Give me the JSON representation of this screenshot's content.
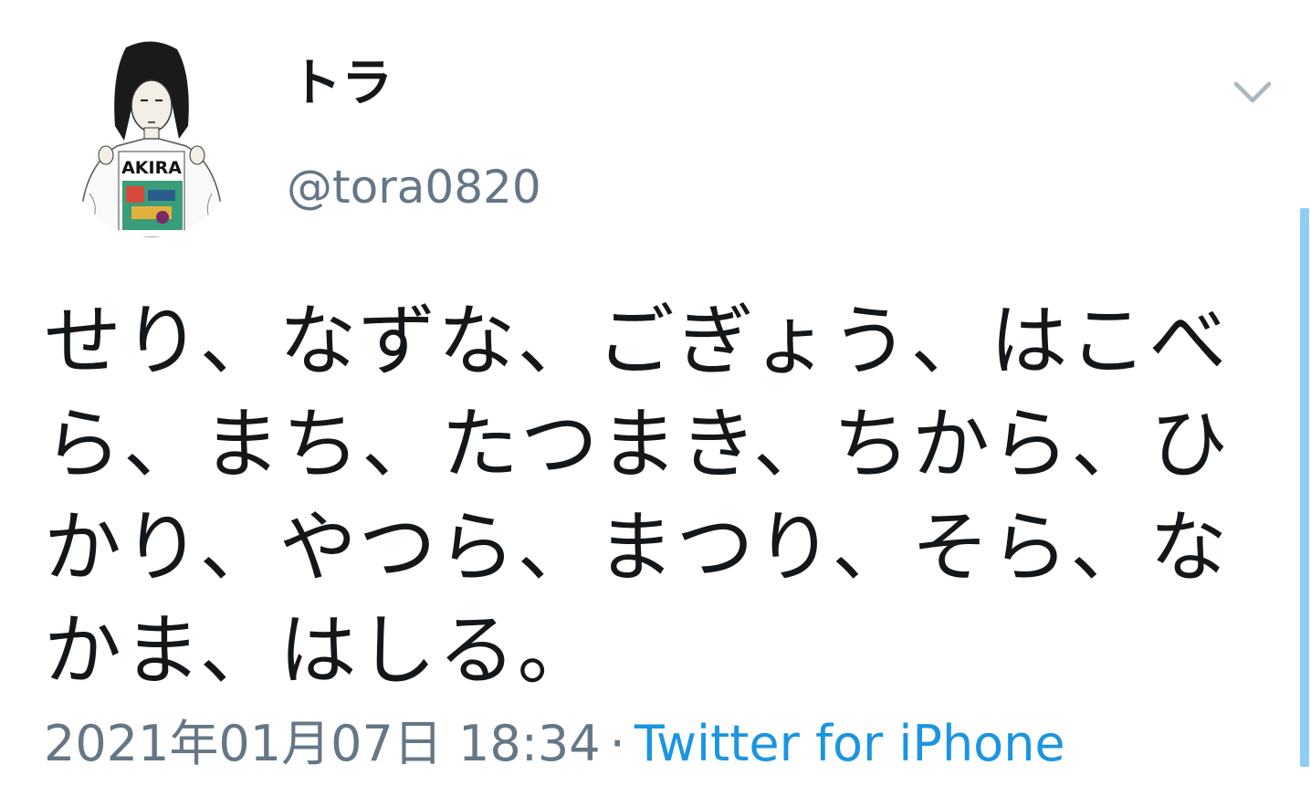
{
  "tweet": {
    "user": {
      "display_name": "トラ",
      "handle": "@tora0820",
      "avatar_shirt_text": "AKIRA"
    },
    "text": "せり、なずな、ごぎょう、はこべら、まち、たつまき、ちから、ひかり、やつら、まつり、そら、なかま、はしる。",
    "timestamp": "2021年01月07日 18:34",
    "separator": "·",
    "source": "Twitter for iPhone"
  },
  "colors": {
    "text": "#14171a",
    "secondary": "#657786",
    "link": "#1b95e0",
    "scrollbar": "#8ecdf4"
  },
  "icons": {
    "menu": "chevron-down-icon"
  }
}
